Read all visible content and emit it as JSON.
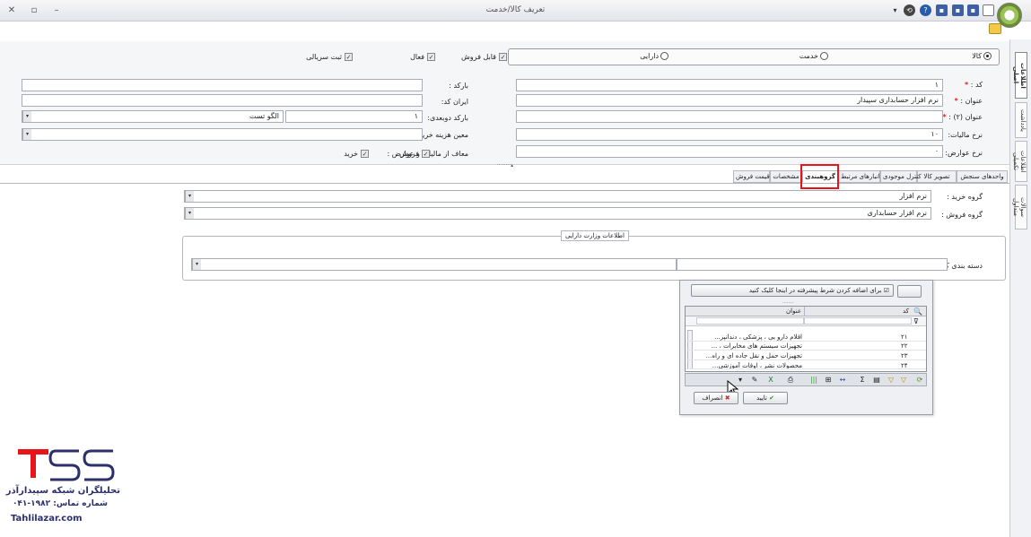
{
  "window": {
    "title": "تعریف کالا/خدمت"
  },
  "vertical_tabs": [
    "اطلاعات اصلی",
    "یادداشت",
    "اطلاعات تکمیلی",
    "سوالات متداول"
  ],
  "product_type": {
    "options": [
      {
        "label": "کالا",
        "selected": true
      },
      {
        "label": "خدمت",
        "selected": false
      },
      {
        "label": "دارایی",
        "selected": false
      }
    ]
  },
  "flags": [
    {
      "label": "قابل فروش",
      "checked": true
    },
    {
      "label": "فعال",
      "checked": true
    },
    {
      "label": "ثبت سریالی",
      "checked": true
    }
  ],
  "form": {
    "code_label": "کد :",
    "code_value": "۱",
    "title_label": "عنوان :",
    "title_value": "نرم افزار حسابداری سپیدار",
    "title2_label": "عنوان (۲) :",
    "title2_value": "",
    "tax_rate_label": "نرخ مالیات:",
    "tax_rate_value": "۱۰",
    "duty_rate_label": "نرخ عوارض:",
    "duty_rate_value": "۰",
    "barcode_label": "بارکد :",
    "barcode_value": "",
    "irancode_label": "ایران کد:",
    "irancode_value": "",
    "weighing_barcode_label": "بارکد دوبعدی:",
    "weighing_barcode_value": "۱",
    "pattern_value": "الگو تست",
    "service_cost_label": "معین هزینه خرید خدمت:",
    "service_cost_value": "",
    "exempt_label": "معاف از مالیات و عوارض :",
    "exempt_sale": "فروش",
    "exempt_purchase": "خرید"
  },
  "tabs": [
    "واحدهای سنجش",
    "تصویر کالا",
    "کنترل موجودی",
    "انبارهای مرتبط",
    "گروهبندی",
    "مشخصات",
    "قیمت فروش"
  ],
  "active_tab": "گروهبندی",
  "grouping": {
    "purchase_group_label": "گروه خرید :",
    "purchase_group_value": "نرم افزار",
    "sale_group_label": "گروه فروش :",
    "sale_group_value": "نرم افزار حسابداری",
    "asset_group_title": "اطلاعات وزارت دارایی",
    "category_label": "دسته بندی کالا:",
    "category_value": ""
  },
  "popup": {
    "filter_hint": "برای اضافه کردن شرط پیشرفته در اینجا کلیک کنید",
    "col_code": "کد",
    "col_title": "عنوان",
    "rows": [
      {
        "code": "۲۱",
        "title": "اقلام دارو یی ، پزشکی ، دندانپز..."
      },
      {
        "code": "۲۲",
        "title": "تجهیزات سیستم های مخابرات ، ..."
      },
      {
        "code": "۲۳",
        "title": "تجهیزات حمل و نقل جاده ای و راه..."
      },
      {
        "code": "۲۴",
        "title": "محصولات نشر ، اوقات آموزشی..."
      }
    ],
    "ok_label": "تایید",
    "cancel_label": "انصراف"
  },
  "watermark": {
    "brand": "تحلیلگران شبکه سپیدارآذر",
    "phone": "شماره تماس: ۱۹۸۲-۰۴۱",
    "site": "Tahlilazar.com"
  },
  "colors": {
    "highlight": "#e8141a",
    "brand": "#2b2f6b",
    "accent_red": "#e8141a"
  }
}
